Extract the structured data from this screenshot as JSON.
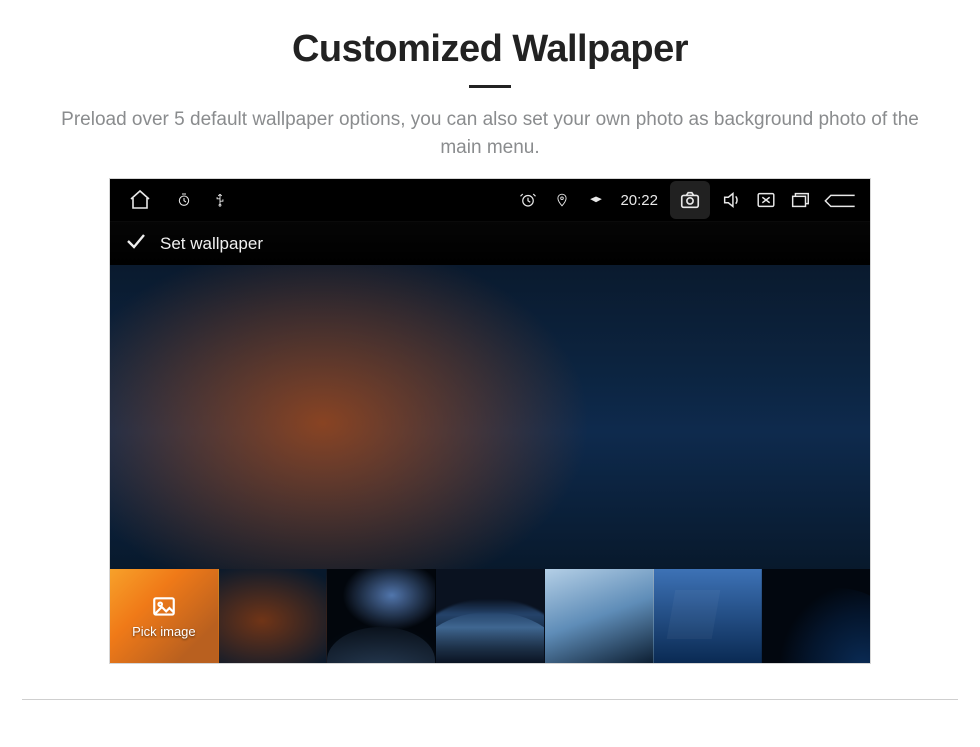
{
  "page": {
    "title": "Customized Wallpaper",
    "subtitle": "Preload over 5 default wallpaper options, you can also set your own photo as background photo of the main menu."
  },
  "statusbar": {
    "time": "20:22",
    "icons": {
      "home": "home-icon",
      "timer": "timer-icon",
      "usb": "usb-icon",
      "alarm": "alarm-icon",
      "location": "location-icon",
      "wifi": "wifi-icon",
      "camera": "camera-icon",
      "volume": "volume-icon",
      "close_app": "close-app-icon",
      "recents": "recents-icon",
      "back": "back-icon"
    }
  },
  "action": {
    "label": "Set wallpaper"
  },
  "thumbnails": {
    "pick_label": "Pick image"
  }
}
